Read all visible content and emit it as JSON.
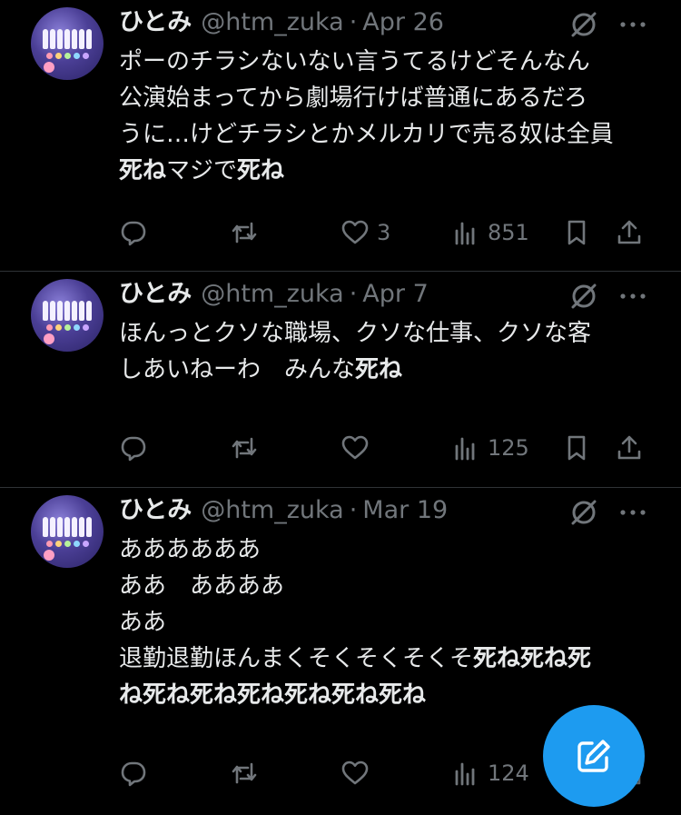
{
  "colors": {
    "background": "#000000",
    "text": "#e7e9ea",
    "muted": "#71767b",
    "divider": "#2f3336",
    "accent": "#1d9bf0"
  },
  "tweets": [
    {
      "name": "ひとみ",
      "handle": "@htm_zuka",
      "separator": "·",
      "date": "Apr 26",
      "lines": [
        [
          {
            "t": "ポーのチラシないない言うてるけどそんなん",
            "b": false
          }
        ],
        [
          {
            "t": "公演始まってから劇場行けば普通にあるだろ",
            "b": false
          }
        ],
        [
          {
            "t": "うに…けどチラシとかメルカリで売る奴は全員",
            "b": false
          }
        ],
        [
          {
            "t": "死ね",
            "b": true
          },
          {
            "t": "マジで",
            "b": false
          },
          {
            "t": "死ね",
            "b": true
          }
        ]
      ],
      "likes": "3",
      "views": "851"
    },
    {
      "name": "ひとみ",
      "handle": "@htm_zuka",
      "separator": "·",
      "date": "Apr 7",
      "lines": [
        [
          {
            "t": "ほんっとクソな職場、クソな仕事、クソな客",
            "b": false
          }
        ],
        [
          {
            "t": "しあいねーわ　みんな",
            "b": false
          },
          {
            "t": "死ね",
            "b": true
          }
        ]
      ],
      "likes": "",
      "views": "125"
    },
    {
      "name": "ひとみ",
      "handle": "@htm_zuka",
      "separator": "·",
      "date": "Mar 19",
      "lines": [
        [
          {
            "t": "ああああああ",
            "b": false
          }
        ],
        [
          {
            "t": "ああ　ああああ",
            "b": false
          }
        ],
        [
          {
            "t": "ああ",
            "b": false
          }
        ],
        [
          {
            "t": "退勤退勤ほんまくそくそくそくそ",
            "b": false
          },
          {
            "t": "死ね死ね死",
            "b": true
          }
        ],
        [
          {
            "t": "ね死ね死ね死ね死ね死ね死ね",
            "b": true
          }
        ]
      ],
      "likes": "",
      "views": "124"
    }
  ],
  "icons": {
    "reply": "reply-icon",
    "retweet": "retweet-icon",
    "like": "heart-icon",
    "views": "views-icon",
    "bookmark": "bookmark-icon",
    "share": "share-icon",
    "grok": "grok-icon",
    "more": "more-icon",
    "compose": "compose-icon"
  }
}
